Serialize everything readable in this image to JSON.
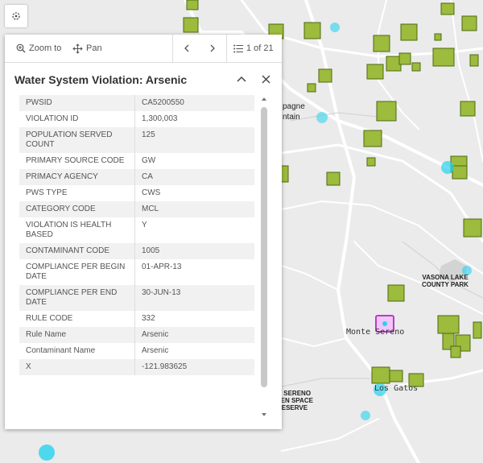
{
  "map": {
    "labels": {
      "champagne": "pagne",
      "fountain": "ntain",
      "vasona": "VASONA LAKE\nCOUNTY PARK",
      "monte_sereno": "Monte Sereno",
      "los_gatos": "Los Gatos",
      "el_sereno": "EL SERENO\nOPEN SPACE\nRESERVE"
    },
    "marker_color": "#9dbb3c",
    "highlight_color": "#b43fc7",
    "point_color": "#27d3ee"
  },
  "popup": {
    "zoom_to_label": "Zoom to",
    "pan_label": "Pan",
    "pager": "1 of 21",
    "title": "Water System Violation: Arsenic",
    "rows": [
      {
        "key": "PWSID",
        "value": "CA5200550"
      },
      {
        "key": "VIOLATION ID",
        "value": "1,300,003"
      },
      {
        "key": "POPULATION SERVED COUNT",
        "value": "125"
      },
      {
        "key": "PRIMARY SOURCE CODE",
        "value": "GW"
      },
      {
        "key": "PRIMACY AGENCY",
        "value": "CA"
      },
      {
        "key": "PWS TYPE",
        "value": "CWS"
      },
      {
        "key": "CATEGORY CODE",
        "value": "MCL"
      },
      {
        "key": "VIOLATION IS HEALTH BASED",
        "value": "Y"
      },
      {
        "key": "CONTAMINANT CODE",
        "value": "1005"
      },
      {
        "key": "COMPLIANCE PER BEGIN DATE",
        "value": "01-APR-13"
      },
      {
        "key": "COMPLIANCE PER END DATE",
        "value": "30-JUN-13"
      },
      {
        "key": "RULE CODE",
        "value": "332"
      },
      {
        "key": "Rule Name",
        "value": "Arsenic"
      },
      {
        "key": "Contaminant Name",
        "value": "Arsenic"
      },
      {
        "key": "X",
        "value": "-121.983625"
      }
    ]
  }
}
